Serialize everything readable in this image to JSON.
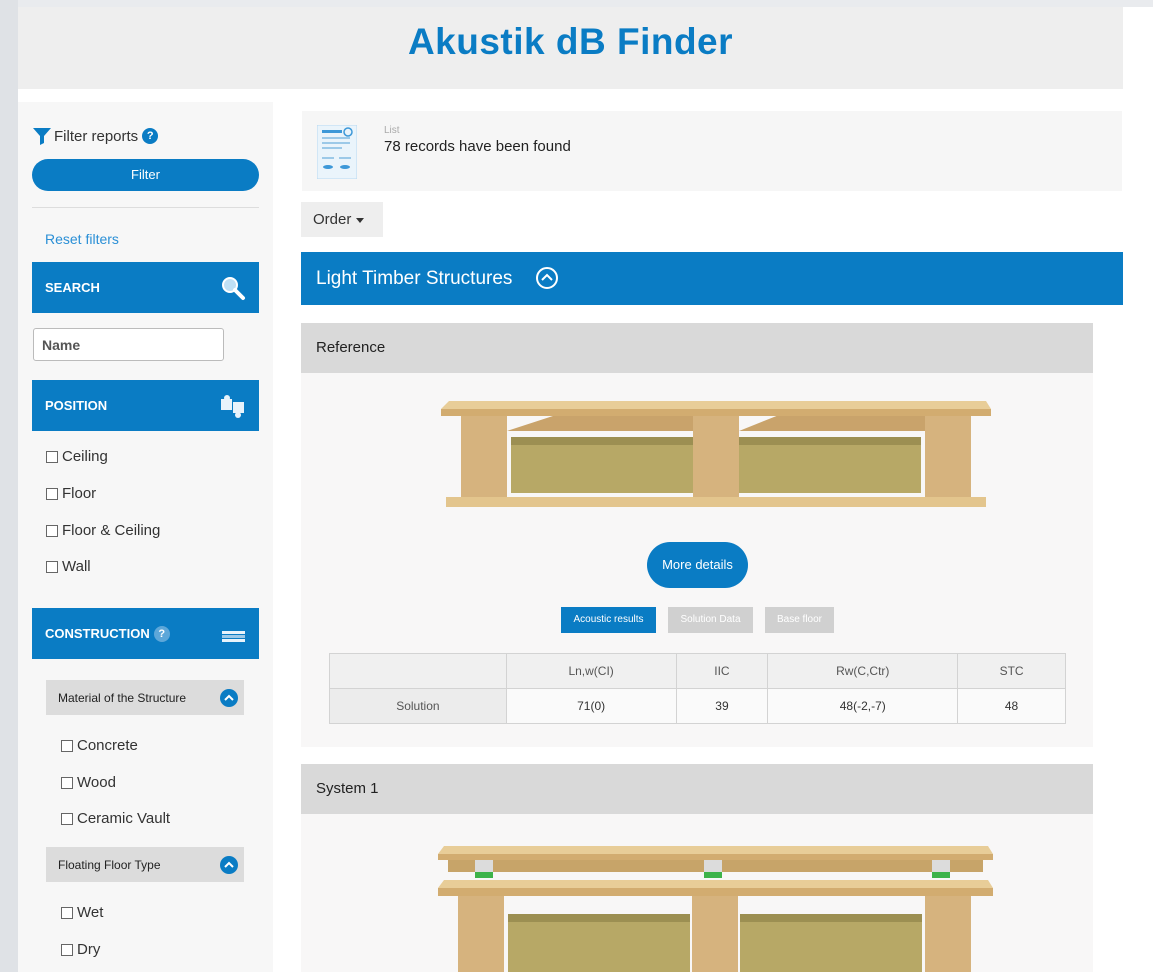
{
  "app": {
    "title": "Akustik dB Finder"
  },
  "sidebar": {
    "filter_title": "Filter reports",
    "help_glyph": "?",
    "filter_button": "Filter",
    "reset_link": "Reset filters",
    "search": {
      "title": "SEARCH",
      "placeholder": "Name"
    },
    "position": {
      "title": "POSITION",
      "options": [
        "Ceiling",
        "Floor",
        "Floor & Ceiling",
        "Wall"
      ]
    },
    "construction": {
      "title": "CONSTRUCTION",
      "material": {
        "title": "Material of the Structure",
        "options": [
          "Concrete",
          "Wood",
          "Ceramic Vault"
        ]
      },
      "floating": {
        "title": "Floating Floor Type",
        "options": [
          "Wet",
          "Dry"
        ]
      }
    }
  },
  "main": {
    "list_label": "List",
    "list_count": "78 records have been found",
    "order_label": "Order",
    "category": "Light Timber Structures",
    "cards": [
      {
        "title": "Reference",
        "more_details": "More details",
        "tabs": [
          "Acoustic results",
          "Solution Data",
          "Base floor"
        ],
        "table": {
          "headers": [
            "",
            "Ln,w(CI)",
            "IIC",
            "Rw(C,Ctr)",
            "STC"
          ],
          "rows": [
            [
              "Solution",
              "71(0)",
              "39",
              "48(-2,-7)",
              "48"
            ]
          ]
        }
      },
      {
        "title": "System 1"
      }
    ]
  },
  "colors": {
    "accent": "#0a7cc4",
    "header_bg": "#eeeeee",
    "card_head": "#d9d9d9"
  }
}
